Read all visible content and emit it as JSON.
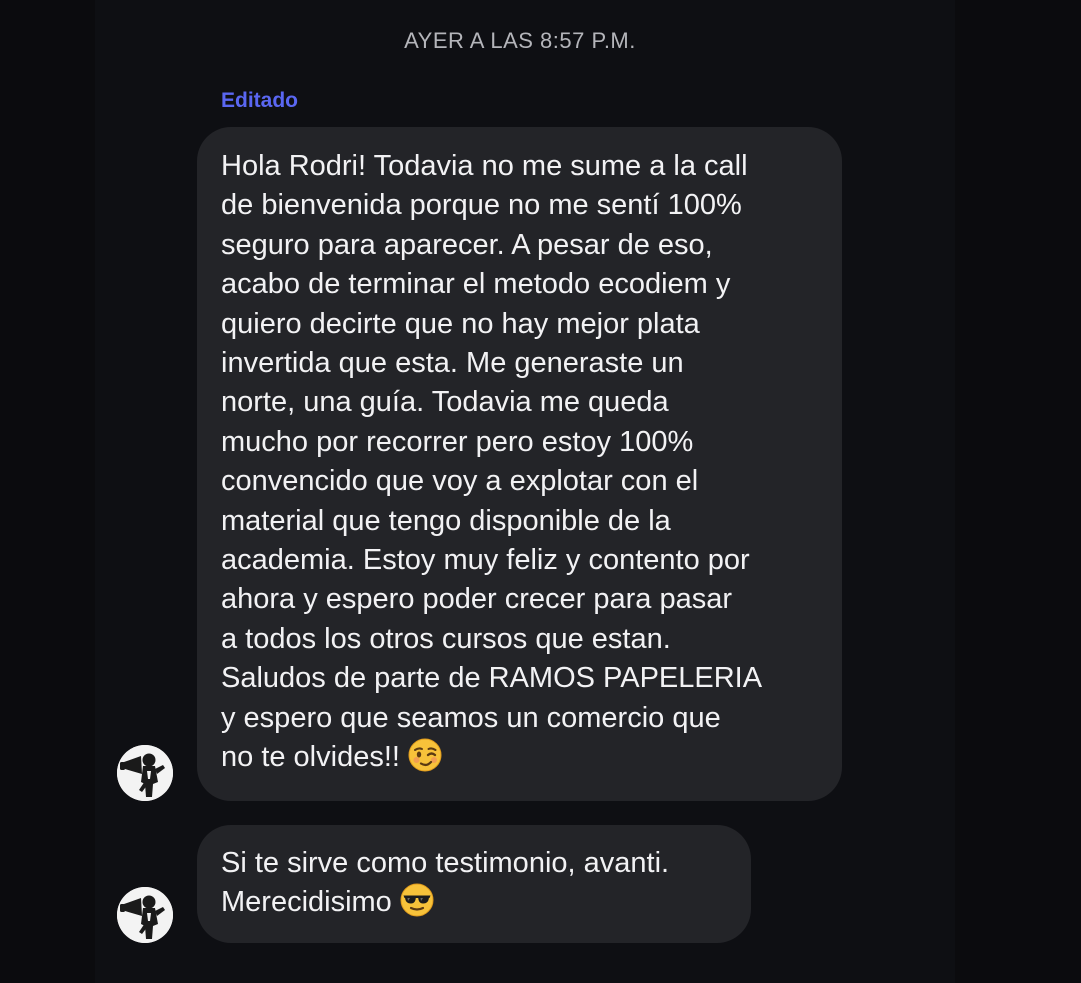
{
  "chat": {
    "timestamp": "AYER A LAS 8:57 P.M.",
    "edited_label": "Editado"
  },
  "messages": [
    {
      "text": "Hola Rodri! Todavia no me sume a la call\nde bienvenida porque no me sentí 100%\nseguro para aparecer. A pesar de eso,\nacabo de terminar el metodo ecodiem y\nquiero decirte que no hay mejor plata\ninvertida que esta. Me generaste un\nnorte, una guía. Todavia me queda\nmucho por recorrer pero estoy 100%\nconvencido que voy a explotar con el\nmaterial que tengo disponible de la\nacademia. Estoy muy feliz y contento por\nahora y espero poder crecer para pasar\na todos los otros cursos que estan.\nSaludos de parte de RAMOS PAPELERIA\ny espero que seamos un comercio que\nno te olvides!!",
      "emoji": "winking-face-emoji",
      "edited": true
    },
    {
      "text": "Si te sirve como testimonio, avanti.\nMerecidisimo",
      "emoji": "sunglasses-face-emoji",
      "edited": false
    }
  ],
  "sender": {
    "avatar": "sender-avatar"
  },
  "colors": {
    "background": "#0b0b0e",
    "bubble": "#232428",
    "edited_label": "#5a67f2",
    "timestamp": "#b4b5ba",
    "message_text": "#f2f2f4"
  }
}
